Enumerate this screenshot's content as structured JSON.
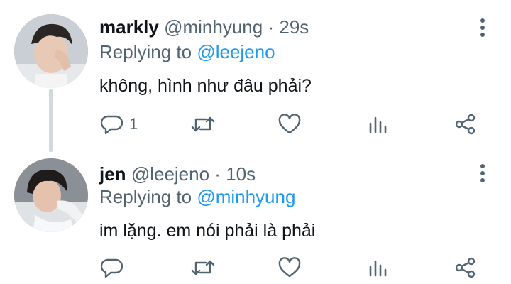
{
  "tweets": [
    {
      "display_name": "markly",
      "handle": "@minhyung",
      "separator": "·",
      "time": "29s",
      "replying_prefix": "Replying to ",
      "replying_to": "@leejeno",
      "text": "không, hình như đâu phải?",
      "reply_count": "1",
      "avatar": "avatar-markly"
    },
    {
      "display_name": "jen",
      "handle": "@leejeno",
      "separator": "·",
      "time": "10s",
      "replying_prefix": "Replying to ",
      "replying_to": "@minhyung",
      "text": "im lặng. em nói phải là phải",
      "reply_count": "",
      "avatar": "avatar-jen"
    }
  ],
  "icons": {
    "reply": "reply-icon",
    "retweet": "retweet-icon",
    "like": "heart-icon",
    "views": "views-icon",
    "share": "share-icon",
    "more": "more-vertical-icon"
  },
  "colors": {
    "text": "#0f1419",
    "muted": "#536471",
    "mention": "#1d9bf0",
    "thread_line": "#cfd9de"
  }
}
